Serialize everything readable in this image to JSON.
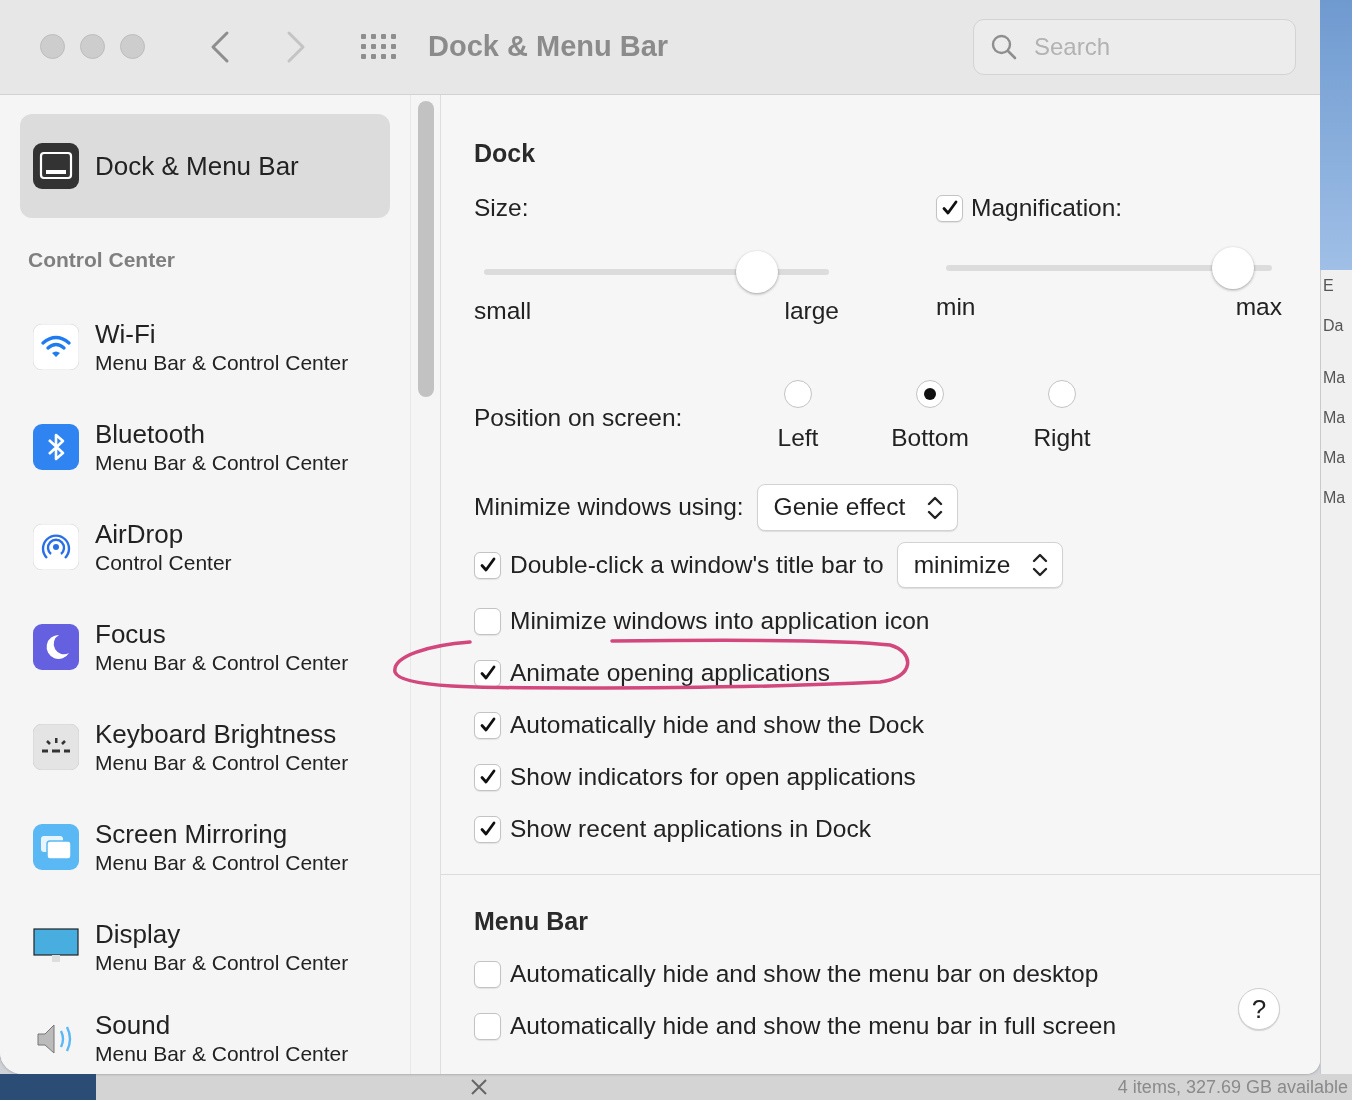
{
  "window": {
    "title": "Dock & Menu Bar",
    "search": {
      "placeholder": "Search"
    }
  },
  "sidebar": {
    "top_items": [
      {
        "label": "Dock & Menu Bar",
        "selected": true
      }
    ],
    "section": {
      "title": "Control Center",
      "items": [
        {
          "label": "Wi-Fi",
          "sublabel": "Menu Bar & Control Center",
          "selected": false
        },
        {
          "label": "Bluetooth",
          "sublabel": "Menu Bar & Control Center",
          "selected": false
        },
        {
          "label": "AirDrop",
          "sublabel": "Control Center",
          "selected": false
        },
        {
          "label": "Focus",
          "sublabel": "Menu Bar & Control Center",
          "selected": false
        },
        {
          "label": "Keyboard Brightness",
          "sublabel": "Menu Bar & Control Center",
          "selected": false
        },
        {
          "label": "Screen Mirroring",
          "sublabel": "Menu Bar & Control Center",
          "selected": false
        },
        {
          "label": "Display",
          "sublabel": "Menu Bar & Control Center",
          "selected": false
        },
        {
          "label": "Sound",
          "sublabel": "Menu Bar & Control Center",
          "selected": false
        }
      ]
    }
  },
  "dock": {
    "title": "Dock",
    "size": {
      "label": "Size:",
      "level": 0.79,
      "min_label": "small",
      "max_label": "large"
    },
    "magnification": {
      "label": "Magnification:",
      "checked": true,
      "level": 0.88,
      "min_label": "min",
      "max_label": "max"
    },
    "position": {
      "label": "Position on screen:",
      "options": [
        {
          "label": "Left",
          "selected": false
        },
        {
          "label": "Bottom",
          "selected": true
        },
        {
          "label": "Right",
          "selected": false
        }
      ]
    },
    "minimize_using": {
      "label": "Minimize windows using:",
      "value": "Genie effect"
    },
    "options": [
      {
        "kind": "popup",
        "label": "Double-click a window's title bar to",
        "checked": true,
        "value": "minimize"
      },
      {
        "kind": "checkbox",
        "label": "Minimize windows into application icon",
        "checked": false
      },
      {
        "kind": "checkbox",
        "label": "Animate opening applications",
        "checked": true
      },
      {
        "kind": "checkbox",
        "label": "Automatically hide and show the Dock",
        "checked": true
      },
      {
        "kind": "checkbox",
        "label": "Show indicators for open applications",
        "checked": true
      },
      {
        "kind": "checkbox",
        "label": "Show recent applications in Dock",
        "checked": true
      }
    ]
  },
  "menu_bar": {
    "title": "Menu Bar",
    "options": [
      {
        "kind": "checkbox",
        "label": "Automatically hide and show the menu bar on desktop",
        "checked": false
      },
      {
        "kind": "checkbox",
        "label": "Automatically hide and show the menu bar in full screen",
        "checked": false
      }
    ],
    "help": "?"
  },
  "background_window": {
    "fragments": [
      "E",
      "Da",
      "Ma",
      "Ma",
      "Ma",
      "Ma"
    ],
    "status": "4 items, 327.69 GB available"
  }
}
